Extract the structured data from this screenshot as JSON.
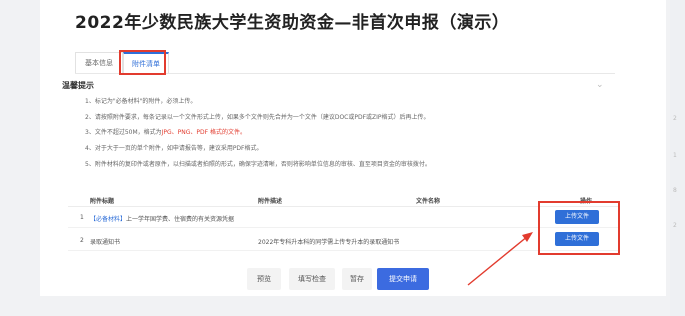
{
  "page": {
    "title": "2022年少数民族大学生资助资金—非首次申报（演示）"
  },
  "tabs": [
    {
      "label": "基本信息"
    },
    {
      "label": "附件清单"
    }
  ],
  "tips": {
    "title": "温馨提示",
    "items": [
      "1、标记为\"必备材料\"的附件，必须上传。",
      "2、请按照附件要求，每条记录以一个文件形式上传，如果多个文件则先合并为一个文件（建议DOC或PDF或ZIP格式）后再上传。",
      "4、对于大于一页的单个附件，如申请报告等，建议采用PDF格式。",
      "5、附件材料的复印件或者原件，以扫描或者拍照的形式，确保字迹清晰，否则将影响单位信息的审核、直至项目资金的审核拨付。"
    ],
    "item3": {
      "prefix": "3、文件不超过50M，格式为",
      "highlight": "JPG、PNG、PDF 格式的文件。"
    }
  },
  "table": {
    "headers": [
      "附件标题",
      "附件描述",
      "文件名称",
      "操作"
    ],
    "rows": [
      {
        "index": "1",
        "tag": "【必备材料】",
        "title": "上一学年国学费、住宿费的有关资源凭据",
        "description": "",
        "filename": "",
        "action": "上传文件"
      },
      {
        "index": "2",
        "tag": "",
        "title": "录取通知书",
        "description": "2022年专科升本科的同学需上传专升本的录取通知书",
        "filename": "",
        "action": "上传文件"
      }
    ]
  },
  "footer": {
    "preview": "预览",
    "check": "填写检查",
    "save": "暂存",
    "submit": "提交申请"
  },
  "colors": {
    "accent": "#2f6fd8",
    "highlight": "#e23b2e"
  },
  "icons": {
    "collapse": "chevron-down-icon"
  }
}
